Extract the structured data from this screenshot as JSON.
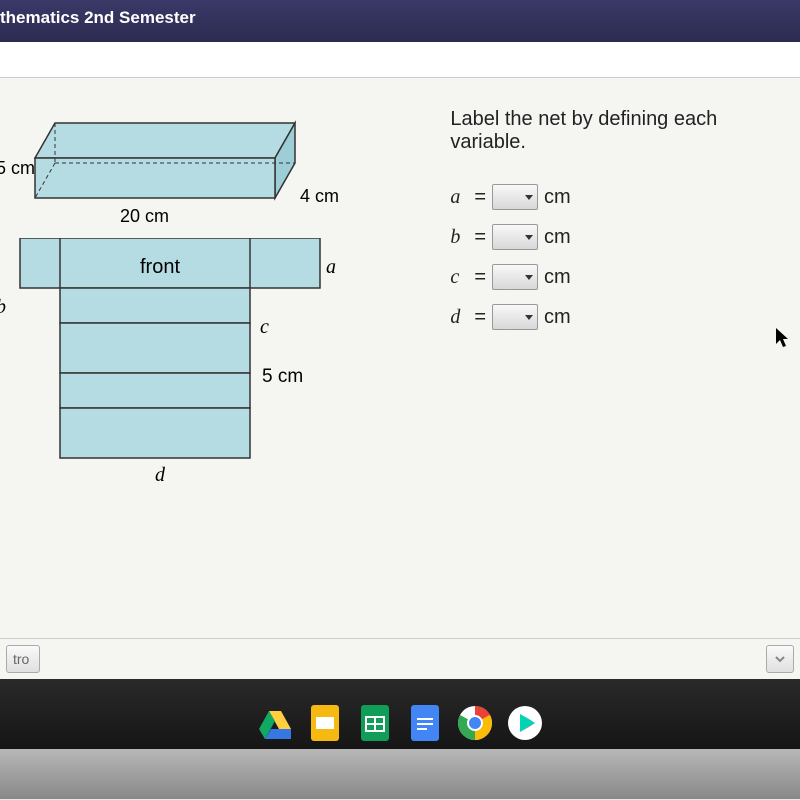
{
  "header": {
    "title": "thematics 2nd Semester"
  },
  "prism": {
    "height_label": "5 cm",
    "width_label": "20 cm",
    "depth_label": "4 cm"
  },
  "net": {
    "front_label": "front",
    "a_label": "a",
    "b_label": "b",
    "c_label": "c",
    "d_label": "d",
    "five_label": "5 cm"
  },
  "instruction": "Label the net by defining each variable.",
  "equations": [
    {
      "var": "a",
      "unit": "cm"
    },
    {
      "var": "b",
      "unit": "cm"
    },
    {
      "var": "c",
      "unit": "cm"
    },
    {
      "var": "d",
      "unit": "cm"
    }
  ],
  "bottom": {
    "tro": "tro"
  }
}
